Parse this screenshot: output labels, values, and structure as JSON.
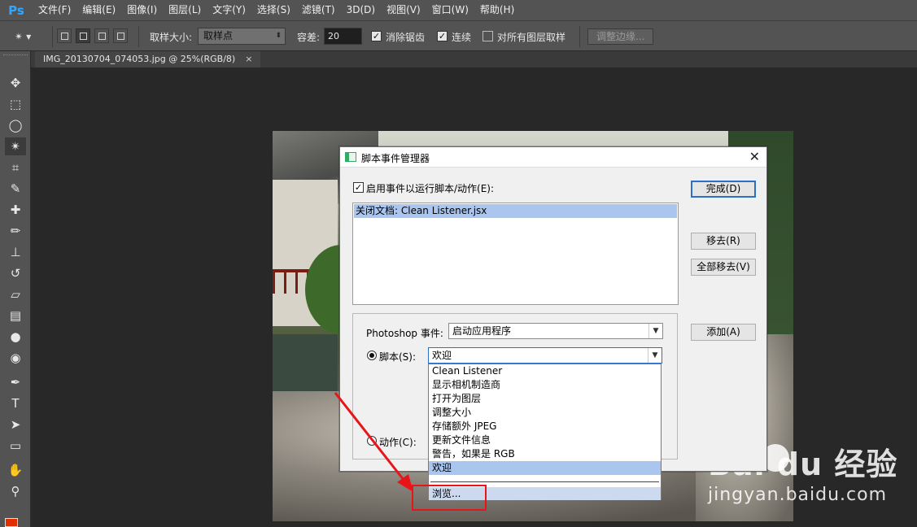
{
  "app": {
    "logo": "Ps"
  },
  "menu": [
    "文件(F)",
    "编辑(E)",
    "图像(I)",
    "图层(L)",
    "文字(Y)",
    "选择(S)",
    "滤镜(T)",
    "3D(D)",
    "视图(V)",
    "窗口(W)",
    "帮助(H)"
  ],
  "options": {
    "sample_size_label": "取样大小:",
    "sample_size_value": "取样点",
    "tolerance_label": "容差:",
    "tolerance_value": "20",
    "antialias_label": "消除锯齿",
    "antialias_checked": true,
    "contiguous_label": "连续",
    "contiguous_checked": true,
    "all_layers_label": "对所有图层取样",
    "all_layers_checked": false,
    "refine_edge_label": "调整边缘..."
  },
  "document_tab": {
    "title": "IMG_20130704_074053.jpg @ 25%(RGB/8)",
    "close": "×"
  },
  "tools": [
    "move-icon",
    "marquee-icon",
    "lasso-icon",
    "magic-wand-icon",
    "crop-icon",
    "eyedropper-icon",
    "healing-brush-icon",
    "brush-icon",
    "clone-stamp-icon",
    "history-brush-icon",
    "eraser-icon",
    "gradient-icon",
    "blur-icon",
    "dodge-icon",
    "pen-icon",
    "type-icon",
    "path-selection-icon",
    "shape-icon",
    "hand-icon",
    "zoom-icon"
  ],
  "foreground_color": "#e03000",
  "dialog": {
    "title": "脚本事件管理器",
    "enable_label": "启用事件以运行脚本/动作(E):",
    "enable_checked": true,
    "events_list": [
      "关闭文档: Clean Listener.jsx"
    ],
    "done_button": "完成(D)",
    "remove_button": "移去(R)",
    "remove_all_button": "全部移去(V)",
    "add_button": "添加(A)",
    "ps_event_label": "Photoshop 事件:",
    "ps_event_value": "启动应用程序",
    "script_label": "脚本(S):",
    "script_value": "欢迎",
    "action_label": "动作(C):"
  },
  "dropdown": {
    "items": [
      "Clean Listener",
      "显示相机制造商",
      "打开为图层",
      "调整大小",
      "存储额外 JPEG",
      "更新文件信息",
      "警告，如果是 RGB",
      "欢迎"
    ],
    "selected_index": 7,
    "browse": "浏览..."
  },
  "watermark": {
    "main": "Bai  du 经验",
    "sub": "jingyan.baidu.com"
  },
  "annotation_color": "#e8141a"
}
